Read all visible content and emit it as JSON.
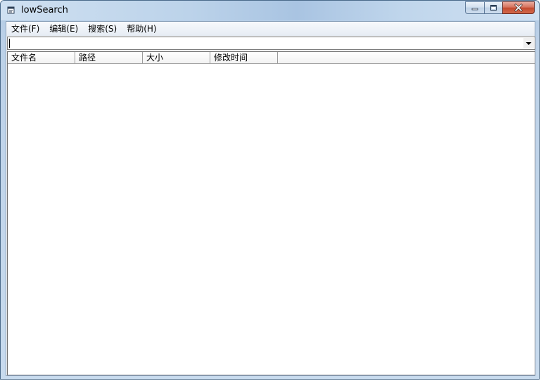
{
  "window": {
    "title": "lowSearch",
    "icon": "app-window-icon"
  },
  "caption": {
    "minimize_icon": "minimize-icon",
    "maximize_icon": "maximize-icon",
    "close_icon": "close-icon"
  },
  "menu": {
    "items": [
      {
        "label": "文件(F)"
      },
      {
        "label": "编辑(E)"
      },
      {
        "label": "搜索(S)"
      },
      {
        "label": "帮助(H)"
      }
    ]
  },
  "search": {
    "value": "",
    "dropdown_icon": "chevron-down-icon"
  },
  "list": {
    "columns": [
      {
        "label": "文件名"
      },
      {
        "label": "路径"
      },
      {
        "label": "大小"
      },
      {
        "label": "修改时间"
      }
    ],
    "rows": []
  },
  "colors": {
    "frame": "#bcd1e8",
    "close_button": "#c44a2f",
    "client": "#f0f0f0"
  }
}
